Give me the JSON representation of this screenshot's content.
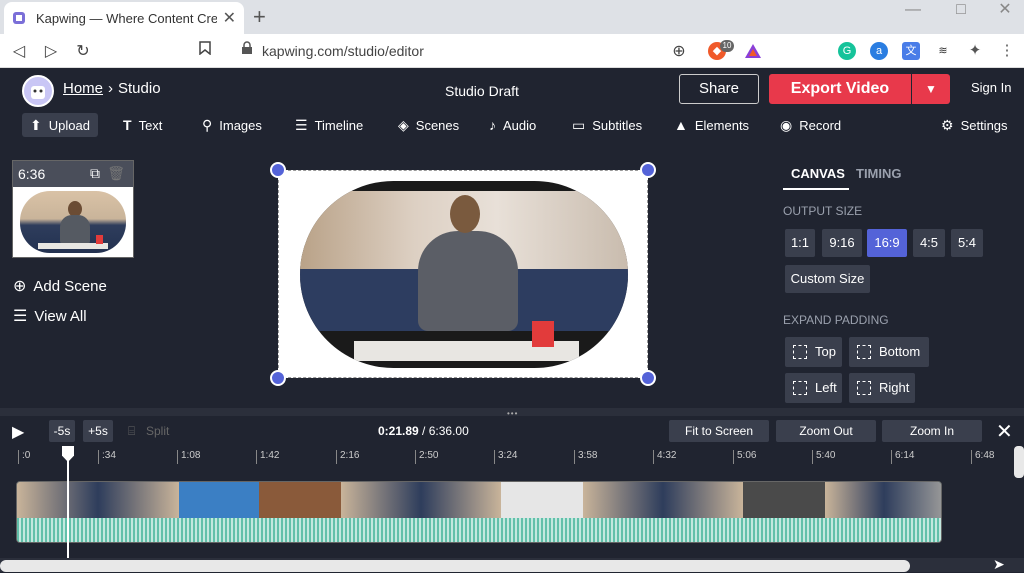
{
  "browser": {
    "tab_title": "Kapwing — Where Content Creat",
    "tab_close": "✕",
    "new_tab": "+",
    "url": "kapwing.com/studio/editor",
    "brave_badge": "10"
  },
  "header": {
    "home": "Home",
    "separator": "›",
    "studio": "Studio",
    "draft_title": "Studio Draft",
    "share_label": "Share",
    "export_label": "Export Video",
    "sign_in": "Sign In"
  },
  "toolbar": {
    "items": [
      {
        "label": "Upload",
        "icon": "upload-icon"
      },
      {
        "label": "Text",
        "icon": "text-icon"
      },
      {
        "label": "Images",
        "icon": "search-icon"
      },
      {
        "label": "Timeline",
        "icon": "timeline-icon"
      },
      {
        "label": "Scenes",
        "icon": "layers-icon"
      },
      {
        "label": "Audio",
        "icon": "music-note-icon"
      },
      {
        "label": "Subtitles",
        "icon": "subtitles-icon"
      },
      {
        "label": "Elements",
        "icon": "shapes-icon"
      },
      {
        "label": "Record",
        "icon": "record-icon"
      },
      {
        "label": "Settings",
        "icon": "gear-icon"
      }
    ]
  },
  "scenes": {
    "duration": "6:36",
    "add_scene": "Add Scene",
    "view_all": "View All"
  },
  "panel": {
    "tab_canvas": "CANVAS",
    "tab_timing": "TIMING",
    "output_size_label": "OUTPUT SIZE",
    "sizes": [
      "1:1",
      "9:16",
      "16:9",
      "4:5",
      "5:4"
    ],
    "active_size": "16:9",
    "custom_size": "Custom Size",
    "expand_padding_label": "EXPAND PADDING",
    "padding": [
      "Top",
      "Bottom",
      "Left",
      "Right"
    ],
    "active_color": "#5463d8"
  },
  "timeline": {
    "minus5": "-5s",
    "plus5": "+5s",
    "split": "Split",
    "current_time": "0:21.89",
    "time_separator": " / ",
    "total_time": "6:36.00",
    "fit_to_screen": "Fit to Screen",
    "zoom_out": "Zoom Out",
    "zoom_in": "Zoom In",
    "ticks": [
      ":0",
      ":34",
      "1:08",
      "1:42",
      "2:16",
      "2:50",
      "3:24",
      "3:58",
      "4:32",
      "5:06",
      "5:40",
      "6:14",
      "6:48"
    ]
  }
}
